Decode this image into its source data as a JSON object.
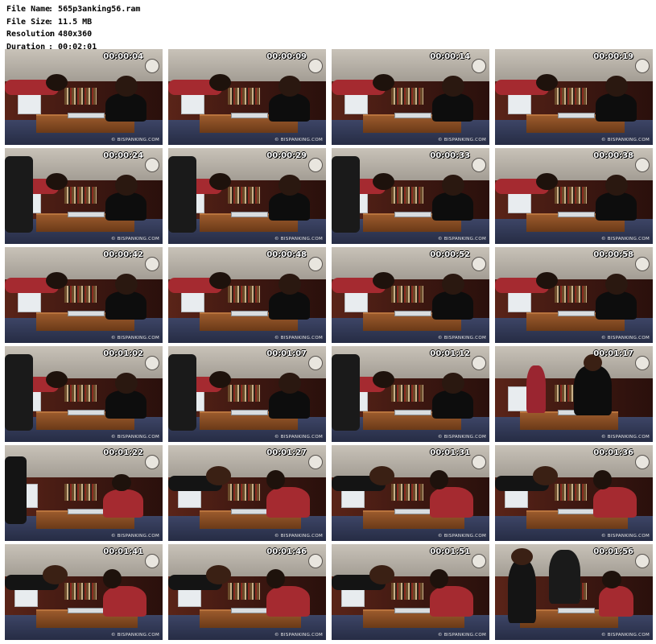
{
  "file_info": [
    {
      "key": "File Name",
      "value": "565p3anking56.ram"
    },
    {
      "key": "File Size",
      "value": "11.5 MB"
    },
    {
      "key": "Resolution",
      "value": "480x360"
    },
    {
      "key": "Duration",
      "value": "00:02:01"
    }
  ],
  "separator": ":",
  "watermark": "© BISPANKING.COM",
  "thumbnails": [
    {
      "time": "00:00:04",
      "scene": "a"
    },
    {
      "time": "00:00:09",
      "scene": "a"
    },
    {
      "time": "00:00:14",
      "scene": "a"
    },
    {
      "time": "00:00:19",
      "scene": "a"
    },
    {
      "time": "00:00:24",
      "scene": "b"
    },
    {
      "time": "00:00:29",
      "scene": "b"
    },
    {
      "time": "00:00:33",
      "scene": "b"
    },
    {
      "time": "00:00:38",
      "scene": "a"
    },
    {
      "time": "00:00:42",
      "scene": "a"
    },
    {
      "time": "00:00:48",
      "scene": "a"
    },
    {
      "time": "00:00:52",
      "scene": "a"
    },
    {
      "time": "00:00:58",
      "scene": "a"
    },
    {
      "time": "00:01:02",
      "scene": "b"
    },
    {
      "time": "00:01:07",
      "scene": "b"
    },
    {
      "time": "00:01:12",
      "scene": "b"
    },
    {
      "time": "00:01:17",
      "scene": "c"
    },
    {
      "time": "00:01:22",
      "scene": "d"
    },
    {
      "time": "00:01:27",
      "scene": "e"
    },
    {
      "time": "00:01:31",
      "scene": "e"
    },
    {
      "time": "00:01:36",
      "scene": "e"
    },
    {
      "time": "00:01:41",
      "scene": "e"
    },
    {
      "time": "00:01:46",
      "scene": "e"
    },
    {
      "time": "00:01:51",
      "scene": "e"
    },
    {
      "time": "00:01:56",
      "scene": "f"
    }
  ]
}
